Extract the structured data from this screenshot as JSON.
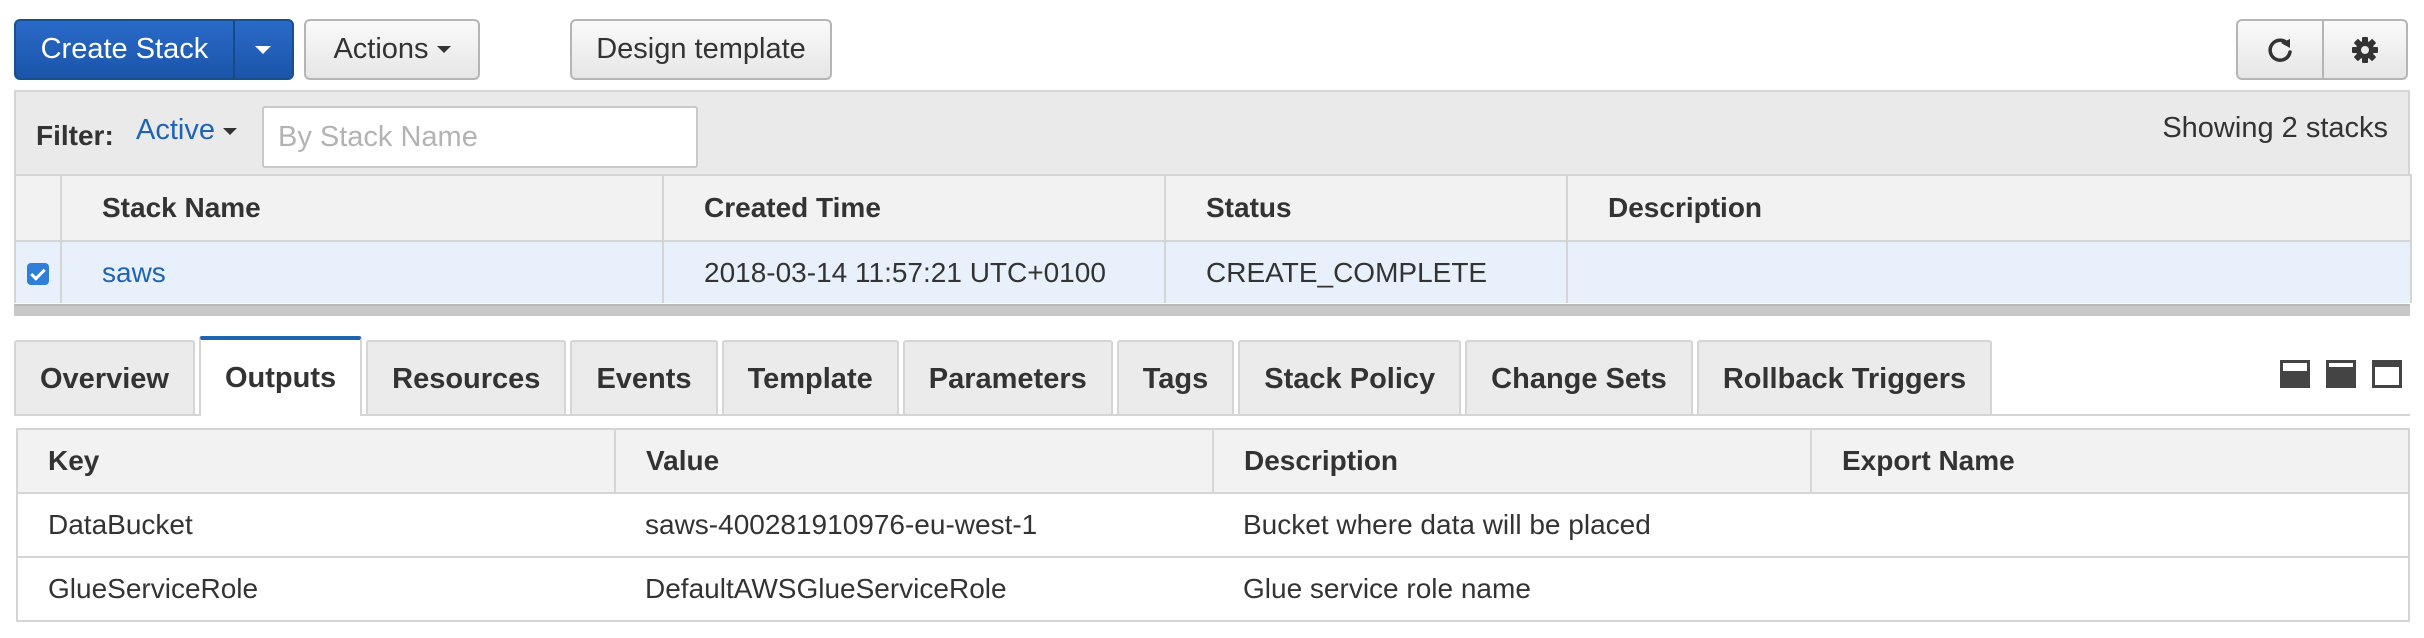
{
  "toolbar": {
    "create_stack_label": "Create Stack",
    "actions_label": "Actions",
    "design_template_label": "Design template",
    "refresh_icon": "refresh-icon",
    "settings_icon": "gear-icon",
    "primary_color": "#1f63b3"
  },
  "filter": {
    "label": "Filter:",
    "active_option": "Active",
    "search_placeholder": "By Stack Name",
    "search_value": "",
    "count_text": "Showing 2 stacks"
  },
  "stacks": {
    "columns": [
      "Stack Name",
      "Created Time",
      "Status",
      "Description"
    ],
    "rows": [
      {
        "selected": true,
        "name": "saws",
        "created_time": "2018-03-14 11:57:21 UTC+0100",
        "status": "CREATE_COMPLETE",
        "description": ""
      }
    ],
    "status_color": "#1e9b2d"
  },
  "tabs": {
    "items": [
      {
        "label": "Overview",
        "active": false
      },
      {
        "label": "Outputs",
        "active": true
      },
      {
        "label": "Resources",
        "active": false
      },
      {
        "label": "Events",
        "active": false
      },
      {
        "label": "Template",
        "active": false
      },
      {
        "label": "Parameters",
        "active": false
      },
      {
        "label": "Tags",
        "active": false
      },
      {
        "label": "Stack Policy",
        "active": false
      },
      {
        "label": "Change Sets",
        "active": false
      },
      {
        "label": "Rollback Triggers",
        "active": false
      }
    ],
    "layout_icons": [
      "layout-bottom-icon",
      "layout-middle-icon",
      "layout-top-icon"
    ]
  },
  "outputs": {
    "columns": [
      "Key",
      "Value",
      "Description",
      "Export Name"
    ],
    "rows": [
      {
        "key": "DataBucket",
        "value": "saws-400281910976-eu-west-1",
        "description": "Bucket where data will be placed",
        "export_name": ""
      },
      {
        "key": "GlueServiceRole",
        "value": "DefaultAWSGlueServiceRole",
        "description": "Glue service role name",
        "export_name": ""
      }
    ]
  }
}
